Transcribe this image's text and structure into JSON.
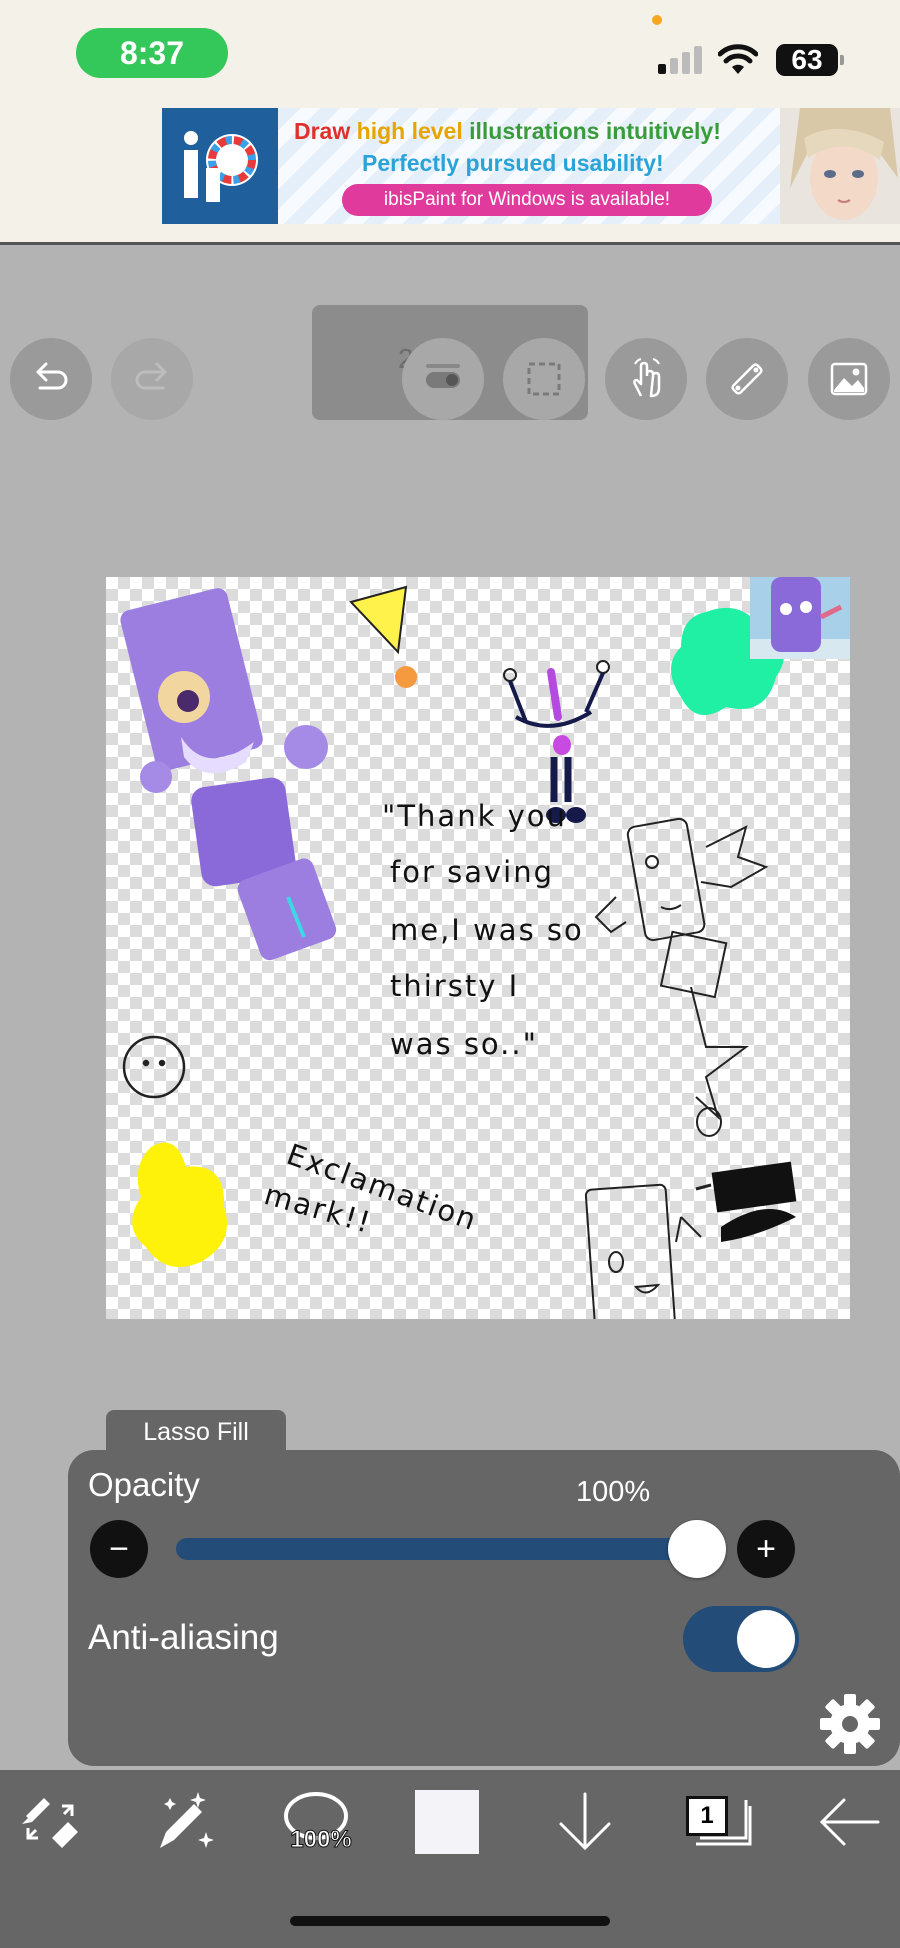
{
  "status_bar": {
    "time": "8:37",
    "battery": "63"
  },
  "ad": {
    "line1_parts": [
      "Draw ",
      "high level ",
      "illustrations ",
      "intuitively!"
    ],
    "line1_colors": [
      "#e0302a",
      "#e8a400",
      "#3a9b3a",
      "#3a9b3a"
    ],
    "line2": "Perfectly pursued usability!",
    "button": "ibisPaint for Windows is available!"
  },
  "toolbar": {
    "zoom": "23.6%"
  },
  "canvas": {
    "note_lines": [
      "\"Thank you",
      "for saving",
      "me,I was so",
      "thirsty I",
      "was so..\""
    ],
    "exclamation_text": [
      "Exclamation",
      "mark!!"
    ]
  },
  "lasso_panel": {
    "tab_title": "Lasso Fill",
    "opacity_label": "Opacity",
    "opacity_value": "100%",
    "opacity_level": 1.0,
    "minus": "−",
    "plus": "+",
    "antialias_label": "Anti-aliasing",
    "antialias_on": true
  },
  "bottom_bar": {
    "brush_size": "100%",
    "layer_count": "1",
    "color": "#f4f4f8"
  },
  "colors": {
    "accent": "#234c78",
    "panel": "#666666",
    "canvas_bg": "#b3b3b3"
  }
}
